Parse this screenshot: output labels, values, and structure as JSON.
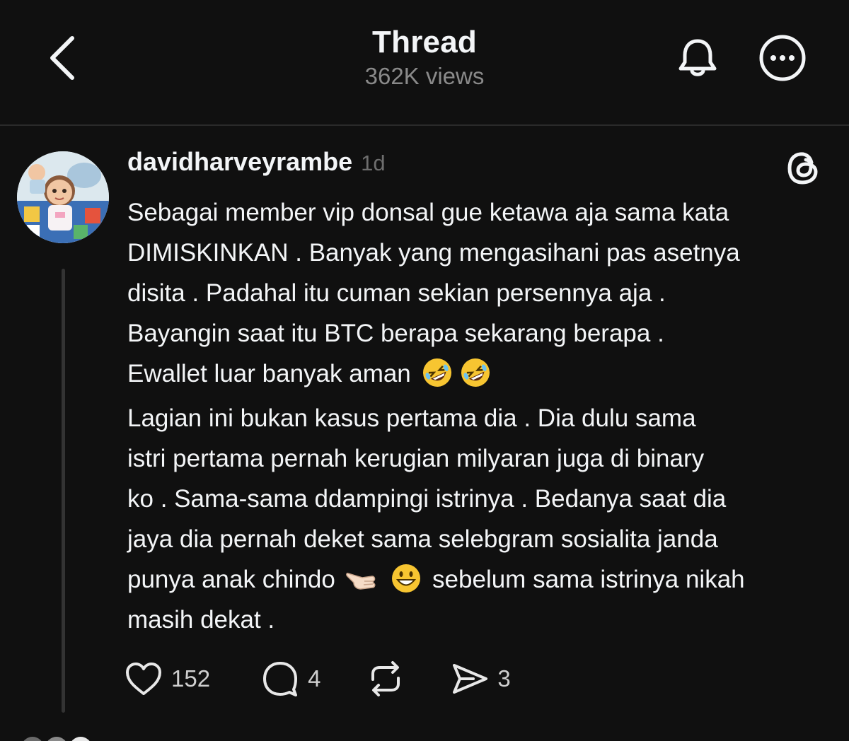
{
  "header": {
    "title": "Thread",
    "views": "362K views",
    "icons": [
      "chevron-left-icon",
      "bell-icon",
      "more-icon"
    ]
  },
  "post": {
    "username": "davidharveyrambe",
    "time": "1d",
    "paragraphs": [
      {
        "lines": [
          "Sebagai member vip donsal gue ketawa aja sama kata",
          "DIMISKINKAN . Banyak yang mengasihani pas asetnya",
          "disita . Padahal itu cuman sekian persennya aja .",
          "Bayangin saat itu BTC berapa sekarang berapa ."
        ],
        "last_line": "Ewallet luar banyak aman"
      },
      {
        "lines": [
          "Lagian ini bukan kasus pertama dia . Dia dulu sama",
          "istri pertama pernah kerugian milyaran juga di binary",
          "ko . Sama-sama ddampingi istrinya . Bedanya saat dia",
          "jaya dia pernah deket sama selebgram sosialita janda"
        ],
        "line_before_emoji": "punya anak chindo",
        "line_after_emoji": "sebelum sama istrinya nikah",
        "final_line": "masih dekat ."
      }
    ],
    "emojis": [
      "rofl-emoji",
      "rofl-emoji",
      "pointing-left-hand-emoji",
      "grinning-face-emoji"
    ],
    "actions": {
      "likes": "152",
      "replies": "4",
      "reposts": "",
      "shares": "3"
    }
  },
  "colors": {
    "background": "#101010",
    "text": "#f3f5f7",
    "muted": "#8a8a8a"
  }
}
